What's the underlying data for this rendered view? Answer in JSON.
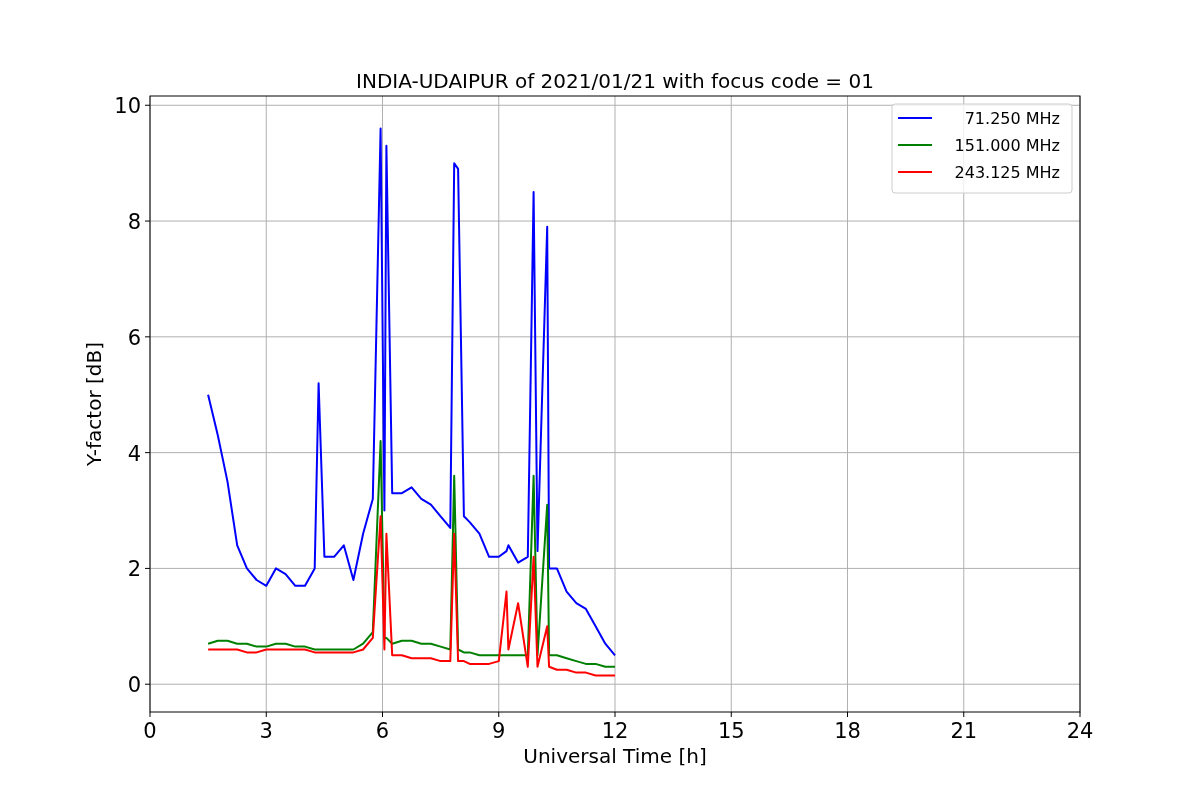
{
  "chart": {
    "chart_data": {
      "type": "line",
      "title": "INDIA-UDAIPUR of 2021/01/21 with focus code = 01",
      "xlabel": "Universal Time [h]",
      "ylabel": "Y-factor [dB]",
      "x": [
        1.5,
        1.75,
        2.0,
        2.25,
        2.5,
        2.75,
        3.0,
        3.25,
        3.5,
        3.75,
        4.0,
        4.25,
        4.35,
        4.5,
        4.75,
        5.0,
        5.25,
        5.5,
        5.75,
        5.95,
        6.05,
        6.1,
        6.25,
        6.5,
        6.75,
        7.0,
        7.25,
        7.5,
        7.75,
        7.85,
        7.95,
        8.1,
        8.25,
        8.5,
        8.75,
        9.0,
        9.2,
        9.25,
        9.5,
        9.75,
        9.9,
        10.0,
        10.25,
        10.3,
        10.5,
        10.75,
        11.0,
        11.25,
        11.5,
        11.75,
        12.0
      ],
      "series": [
        {
          "name": "71.250 MHz",
          "color": "#0000ff",
          "values": [
            5.0,
            4.3,
            3.5,
            2.4,
            2.0,
            1.8,
            1.7,
            2.0,
            1.9,
            1.7,
            1.7,
            2.0,
            5.2,
            2.2,
            2.2,
            2.4,
            1.8,
            2.6,
            3.2,
            9.6,
            3.0,
            9.3,
            3.3,
            3.3,
            3.4,
            3.2,
            3.1,
            2.9,
            2.7,
            9.0,
            8.9,
            2.9,
            2.8,
            2.6,
            2.2,
            2.2,
            2.3,
            2.4,
            2.1,
            2.2,
            8.5,
            2.3,
            7.9,
            2.0,
            2.0,
            1.6,
            1.4,
            1.3,
            1.0,
            0.7,
            0.5
          ]
        },
        {
          "name": "151.000 MHz",
          "color": "#008000",
          "values": [
            0.7,
            0.75,
            0.75,
            0.7,
            0.7,
            0.65,
            0.65,
            0.7,
            0.7,
            0.65,
            0.65,
            0.6,
            0.6,
            0.6,
            0.6,
            0.6,
            0.6,
            0.7,
            0.9,
            4.2,
            0.8,
            0.8,
            0.7,
            0.75,
            0.75,
            0.7,
            0.7,
            0.65,
            0.6,
            3.6,
            0.6,
            0.55,
            0.55,
            0.5,
            0.5,
            0.5,
            0.5,
            0.5,
            0.5,
            0.5,
            3.6,
            0.5,
            3.1,
            0.5,
            0.5,
            0.45,
            0.4,
            0.35,
            0.35,
            0.3,
            0.3
          ]
        },
        {
          "name": "243.125 MHz",
          "color": "#ff0000",
          "values": [
            0.6,
            0.6,
            0.6,
            0.6,
            0.55,
            0.55,
            0.6,
            0.6,
            0.6,
            0.6,
            0.6,
            0.55,
            0.55,
            0.55,
            0.55,
            0.55,
            0.55,
            0.6,
            0.8,
            2.9,
            0.6,
            2.6,
            0.5,
            0.5,
            0.45,
            0.45,
            0.45,
            0.4,
            0.4,
            2.6,
            0.4,
            0.4,
            0.35,
            0.35,
            0.35,
            0.4,
            1.6,
            0.6,
            1.4,
            0.3,
            2.2,
            0.3,
            1.0,
            0.3,
            0.25,
            0.25,
            0.2,
            0.2,
            0.15,
            0.15,
            0.15
          ]
        }
      ],
      "grid": true,
      "legend": "upper right",
      "xlim": [
        0,
        24
      ],
      "ylim": [
        -0.48,
        10.16
      ],
      "xticks": [
        0,
        3,
        6,
        9,
        12,
        15,
        18,
        21,
        24
      ],
      "yticks": [
        0,
        2,
        4,
        6,
        8,
        10
      ]
    }
  }
}
